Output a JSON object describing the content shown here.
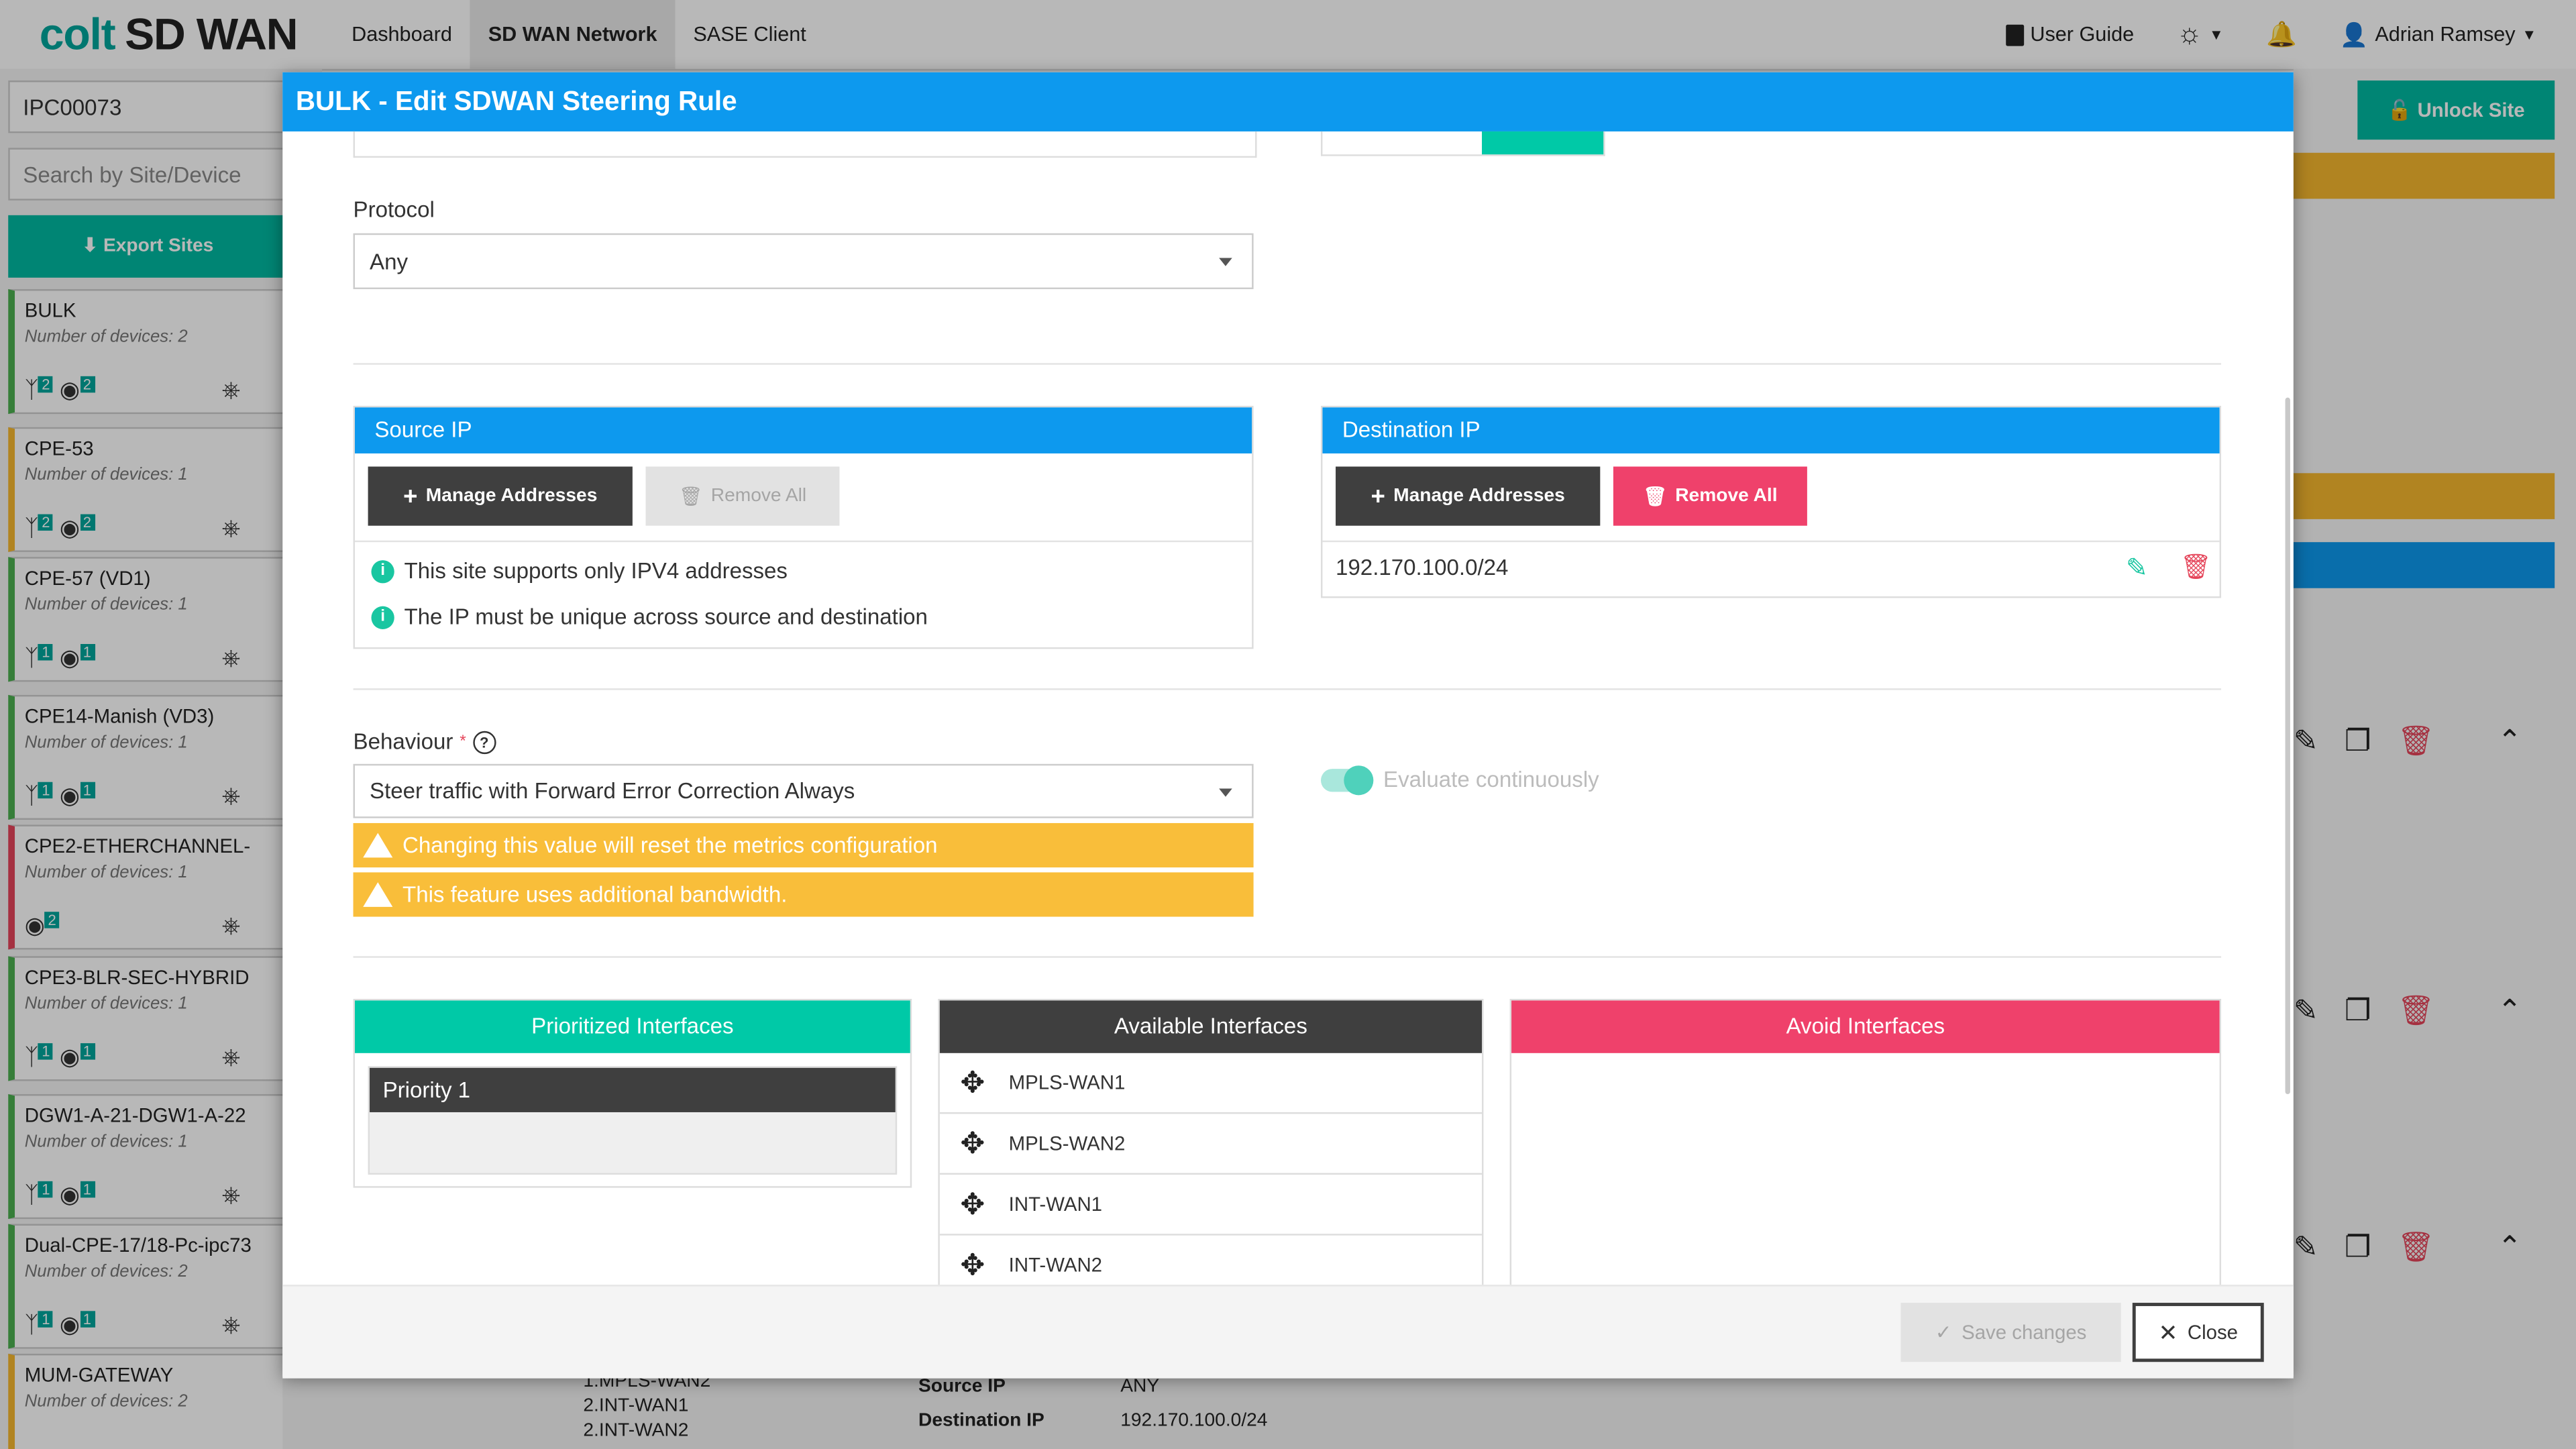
{
  "app": {
    "logo_brand": "colt",
    "logo_product": "SD WAN",
    "nav": [
      {
        "label": "Dashboard",
        "active": false
      },
      {
        "label": "SD WAN Network",
        "active": true
      },
      {
        "label": "SASE Client",
        "active": false
      }
    ],
    "user_guide": "User Guide",
    "user_name": "Adrian Ramsey"
  },
  "sidebar": {
    "site_value": "IPC00073",
    "search_placeholder": "Search by Site/Device",
    "export_label": "Export Sites",
    "sites": [
      {
        "name": "BULK",
        "devices": "Number of devices: 2",
        "border": "#4caf50",
        "b1": "2",
        "b2": "2"
      },
      {
        "name": "CPE-53",
        "devices": "Number of devices: 1",
        "border": "#f5b82e",
        "b1": "2",
        "b2": "2"
      },
      {
        "name": "CPE-57 (VD1)",
        "devices": "Number of devices: 1",
        "border": "#4caf50",
        "b1": "1",
        "b2": "1"
      },
      {
        "name": "CPE14-Manish (VD3)",
        "devices": "Number of devices: 1",
        "border": "#4caf50",
        "b1": "1",
        "b2": "1"
      },
      {
        "name": "CPE2-ETHERCHANNEL-",
        "devices": "Number of devices: 1",
        "border": "#e5455a",
        "b1": "",
        "b2": "2"
      },
      {
        "name": "CPE3-BLR-SEC-HYBRID",
        "devices": "Number of devices: 1",
        "border": "#4caf50",
        "b1": "1",
        "b2": "1"
      },
      {
        "name": "DGW1-A-21-DGW1-A-22",
        "devices": "Number of devices: 1",
        "border": "#4caf50",
        "b1": "1",
        "b2": "1"
      },
      {
        "name": "Dual-CPE-17/18-Pc-ipc73",
        "devices": "Number of devices: 2",
        "border": "#4caf50",
        "b1": "1",
        "b2": "1"
      },
      {
        "name": "MUM-GATEWAY",
        "devices": "Number of devices: 2",
        "border": "#f5b82e",
        "b1": "",
        "b2": ""
      }
    ]
  },
  "right_pane": {
    "unlock_label": "Unlock Site"
  },
  "background_footer": {
    "list": [
      "1.MPLS-WAN2",
      "2.INT-WAN1",
      "2.INT-WAN2"
    ],
    "source_ip_label": "Source IP",
    "source_ip_value": "ANY",
    "dest_ip_label": "Destination IP",
    "dest_ip_value": "192.170.100.0/24"
  },
  "modal": {
    "title": "BULK - Edit SDWAN Steering Rule",
    "protocol_label": "Protocol",
    "protocol_value": "Any",
    "source_ip": {
      "title": "Source IP",
      "manage_label": "Manage Addresses",
      "remove_all_label": "Remove All",
      "info": [
        "This site supports only IPV4 addresses",
        "The IP must be unique across source and destination"
      ]
    },
    "destination_ip": {
      "title": "Destination IP",
      "manage_label": "Manage Addresses",
      "remove_all_label": "Remove All",
      "addresses": [
        "192.170.100.0/24"
      ]
    },
    "behaviour_label": "Behaviour",
    "behaviour_required": "*",
    "behaviour_value": "Steer traffic with Forward Error Correction Always",
    "warnings": [
      "Changing this value will reset the metrics configuration",
      "This feature uses additional bandwidth."
    ],
    "evaluate_label": "Evaluate continuously",
    "evaluate_on": true,
    "prioritized": {
      "title": "Prioritized Interfaces",
      "priority_label": "Priority 1"
    },
    "available": {
      "title": "Available Interfaces",
      "items": [
        "MPLS-WAN1",
        "MPLS-WAN2",
        "INT-WAN1",
        "INT-WAN2"
      ]
    },
    "avoid": {
      "title": "Avoid Interfaces"
    },
    "save_label": "Save changes",
    "close_label": "Close"
  },
  "colors": {
    "brand": "#00a59b",
    "primary_blue": "#0d99ee",
    "teal": "#00c9a7",
    "pink": "#ef416b",
    "warning": "#f9be3a",
    "dark": "#3f3f3f"
  }
}
